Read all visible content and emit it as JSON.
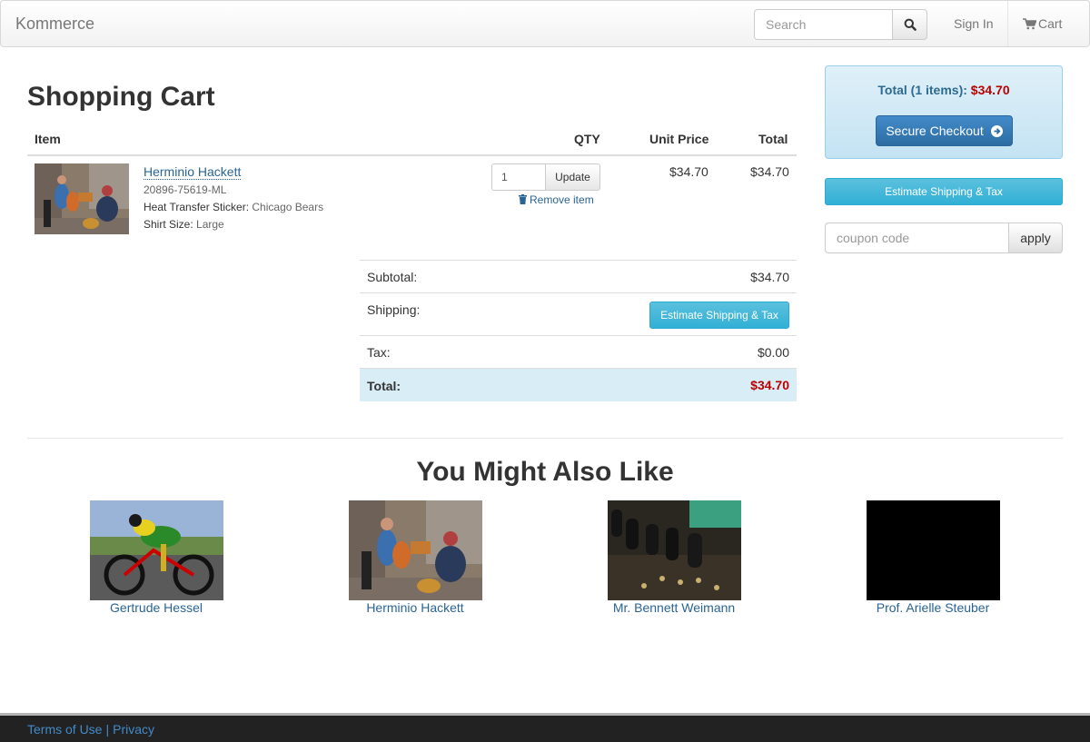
{
  "navbar": {
    "brand": "Kommerce",
    "search_placeholder": "Search",
    "sign_in": "Sign In",
    "cart": "Cart"
  },
  "cart": {
    "title": "Shopping Cart",
    "headers": {
      "item": "Item",
      "qty": "QTY",
      "unit_price": "Unit Price",
      "total": "Total"
    },
    "item": {
      "name": "Herminio Hackett",
      "sku": "20896-75619-ML",
      "option1_label": "Heat Transfer Sticker:",
      "option1_value": "Chicago Bears",
      "option2_label": "Shirt Size:",
      "option2_value": "Large",
      "qty": "1",
      "update_label": "Update",
      "remove_label": "Remove item",
      "unit_price": "$34.70",
      "total": "$34.70"
    },
    "summary": {
      "subtotal_label": "Subtotal:",
      "subtotal": "$34.70",
      "shipping_label": "Shipping:",
      "estimate_label": "Estimate Shipping & Tax",
      "tax_label": "Tax:",
      "tax": "$0.00",
      "total_label": "Total:",
      "total": "$34.70"
    }
  },
  "sidebar": {
    "total_label": "Total (1 items):",
    "total_value": "$34.70",
    "checkout_label": "Secure Checkout",
    "estimate_label": "Estimate Shipping & Tax",
    "coupon_placeholder": "coupon code",
    "apply_label": "apply"
  },
  "also_like": {
    "title": "You Might Also Like",
    "products": [
      {
        "name": "Gertrude Hessel"
      },
      {
        "name": "Herminio Hackett"
      },
      {
        "name": "Mr. Bennett Weimann"
      },
      {
        "name": "Prof. Arielle Steuber"
      }
    ]
  },
  "footer": {
    "terms": "Terms of Use",
    "separator": "|",
    "privacy": "Privacy"
  }
}
